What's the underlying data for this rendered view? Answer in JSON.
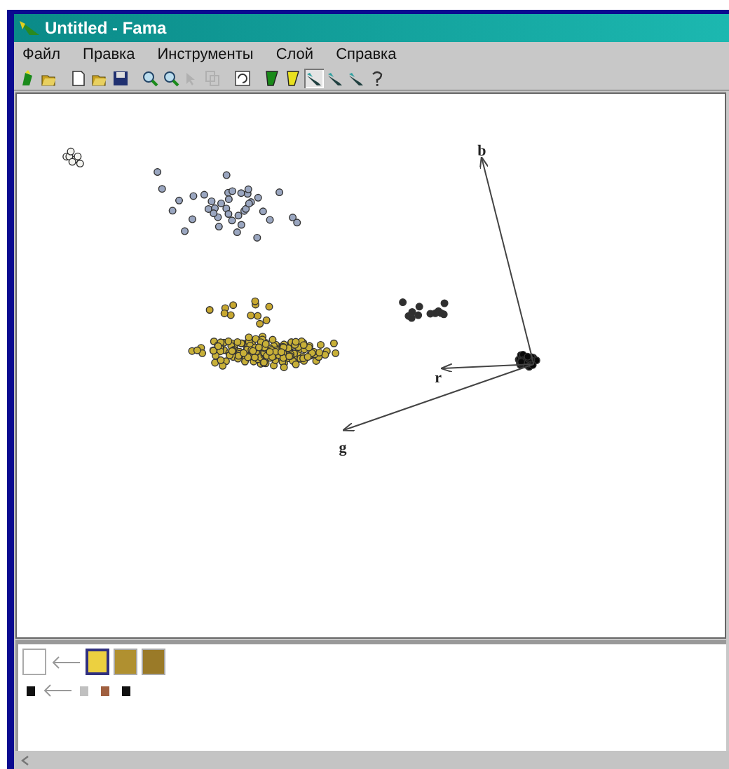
{
  "window": {
    "title": "Untitled - Fama"
  },
  "menu": [
    "Файл",
    "Правка",
    "Инструменты",
    "Слой",
    "Справка"
  ],
  "toolbar": [
    {
      "kind": "layer-add",
      "disabled": false
    },
    {
      "kind": "open",
      "disabled": false
    },
    {
      "kind": "sep"
    },
    {
      "kind": "new",
      "disabled": false
    },
    {
      "kind": "open",
      "disabled": false
    },
    {
      "kind": "save",
      "disabled": false
    },
    {
      "kind": "sep"
    },
    {
      "kind": "zoom-in",
      "disabled": false
    },
    {
      "kind": "zoom-out",
      "disabled": false
    },
    {
      "kind": "pointer",
      "disabled": true
    },
    {
      "kind": "copy",
      "disabled": true
    },
    {
      "kind": "sep"
    },
    {
      "kind": "rotate",
      "disabled": false
    },
    {
      "kind": "sep"
    },
    {
      "kind": "fill",
      "disabled": false,
      "color": "#1a8a1a"
    },
    {
      "kind": "fill",
      "disabled": false,
      "color": "#e8e020"
    },
    {
      "kind": "pen",
      "disabled": false,
      "selected": true
    },
    {
      "kind": "pen",
      "disabled": false,
      "selected": false
    },
    {
      "kind": "pen",
      "disabled": false,
      "selected": false
    },
    {
      "kind": "help",
      "disabled": false
    }
  ],
  "plot": {
    "axes": [
      {
        "label": "b"
      },
      {
        "label": "r"
      },
      {
        "label": "g"
      }
    ]
  },
  "legend": {
    "swatches": [
      {
        "color": "#ffffff",
        "selected": false
      },
      {
        "color": "#ecd040",
        "selected": true
      },
      {
        "color": "#b09030",
        "selected": false
      },
      {
        "color": "#9a7a28",
        "selected": false
      }
    ],
    "markers": [
      {
        "color": "#111111"
      },
      {
        "color": "#c0c0c0"
      },
      {
        "color": "#a06040"
      },
      {
        "color": "#111111"
      }
    ]
  }
}
